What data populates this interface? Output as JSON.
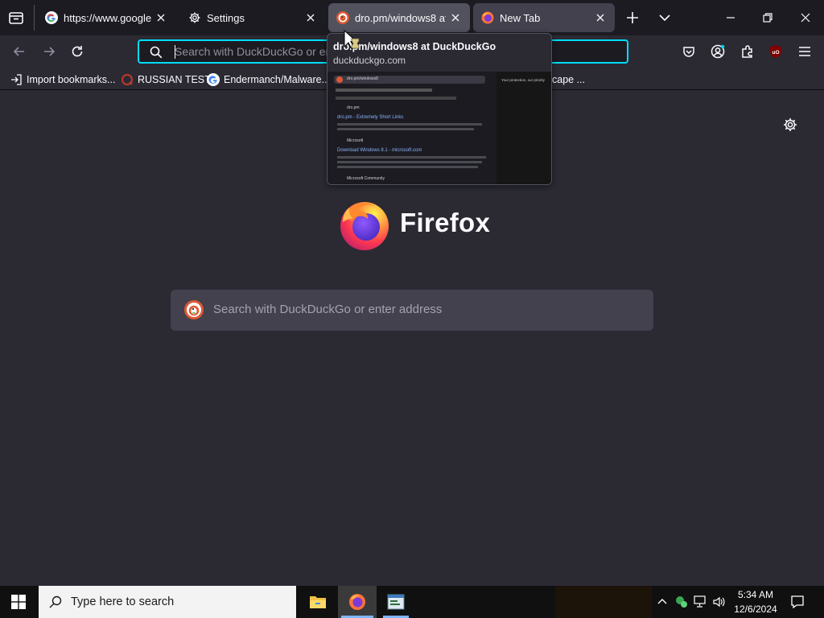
{
  "tabs": [
    {
      "title": "https://www.google.com",
      "icon": "google-icon",
      "state": "normal"
    },
    {
      "title": "Settings",
      "icon": "gear-icon",
      "state": "normal"
    },
    {
      "title": "dro.pm/windows8 at DuckDuckGo",
      "icon": "duckduckgo-icon",
      "state": "hover"
    },
    {
      "title": "New Tab",
      "icon": "firefox-icon",
      "state": "selected"
    }
  ],
  "urlbar": {
    "placeholder": "Search with DuckDuckGo or enter address",
    "visible_text": "Search with DuckDuckGo or en"
  },
  "bookmarks": [
    {
      "label": "Import bookmarks...",
      "icon": "import-icon"
    },
    {
      "label": "RUSSIAN TEST",
      "icon": "site-icon"
    },
    {
      "label": "Endermanch/Malware...",
      "icon": "google-icon"
    },
    {
      "label": "cape ...",
      "icon": ""
    }
  ],
  "preview": {
    "title": "dro.pm/windows8 at DuckDuckGo",
    "url": "duckduckgo.com",
    "thumb": {
      "query": "dro.pm/windows8",
      "side_text": "Your protection, our priority",
      "results": [
        {
          "site": "dro.pm",
          "title": "dro.pm - Extremely Short Links"
        },
        {
          "site": "Microsoft",
          "title": "Download Windows 8.1 - microsoft.com"
        },
        {
          "site": "Microsoft Community",
          "title": ""
        }
      ]
    }
  },
  "newtab": {
    "brand": "Firefox",
    "search_placeholder": "Search with DuckDuckGo or enter address"
  },
  "taskbar": {
    "search_text": "Type here to search",
    "time": "5:34 AM",
    "date": "12/6/2024"
  },
  "colors": {
    "accent": "#00ddff",
    "toolbar": "#2b2a33",
    "tabstrip": "#1c1b22",
    "ublock": "#800000"
  }
}
